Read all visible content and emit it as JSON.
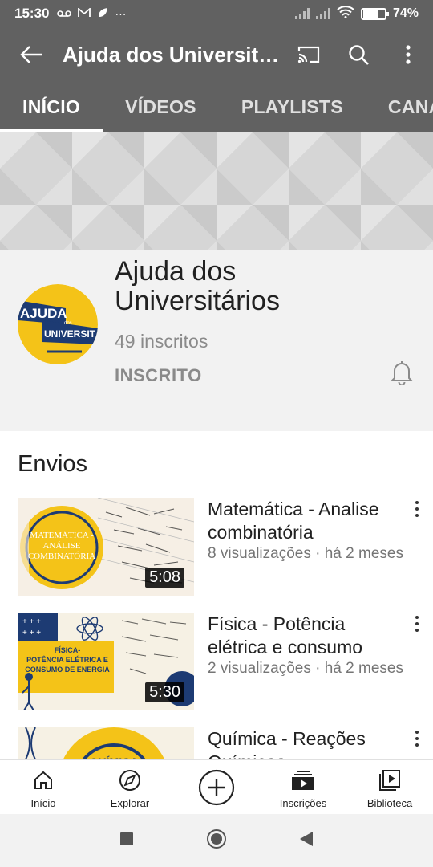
{
  "status_bar": {
    "time": "15:30",
    "battery": "74%",
    "battery_level": 0.74,
    "icons": [
      "voicemail-icon",
      "gmail-icon",
      "leaf-icon",
      "more-icon",
      "signal-icon",
      "signal-icon",
      "wifi-icon",
      "battery-icon"
    ],
    "more": "···"
  },
  "app_bar": {
    "title": "Ajuda dos Universit…",
    "icons": [
      "back-arrow-icon",
      "cast-icon",
      "search-icon",
      "more-vert-icon"
    ]
  },
  "tabs": [
    {
      "label": "INÍCIO",
      "active": true
    },
    {
      "label": "VÍDEOS",
      "active": false
    },
    {
      "label": "PLAYLISTS",
      "active": false
    },
    {
      "label": "CANA",
      "active": false
    }
  ],
  "channel": {
    "name": "Ajuda dos Universitários",
    "subscribers": "49 inscritos",
    "subscribed_label": "INSCRITO",
    "avatar": {
      "line1": "AJUDA",
      "line2": "dos",
      "line3": "UNIVERSITÁR",
      "colors": {
        "yellow": "#f4c318",
        "navy": "#1d3b73"
      }
    }
  },
  "section": {
    "title": "Envios"
  },
  "videos": [
    {
      "title": "Matemática - Analise combinatória",
      "meta": "8 visualizações · há 2 meses",
      "duration": "5:08",
      "thumb_text": "MATEMÁTICA - ANÁLISE COMBINATÓRIA"
    },
    {
      "title": "Física - Potência elétrica e consumo",
      "meta": "2 visualizações · há 2 meses",
      "duration": "5:30",
      "thumb_text": "FÍSICA- POTÊNCIA ELÉTRICA E CONSUMO DE ENERGIA"
    },
    {
      "title": "Química - Reações Químicas",
      "meta": "",
      "duration": "",
      "thumb_text": "QUÍMICA"
    }
  ],
  "bottom_nav": [
    {
      "label": "Início",
      "icon": "home-icon"
    },
    {
      "label": "Explorar",
      "icon": "compass-icon"
    },
    {
      "label": "",
      "icon": "create-icon"
    },
    {
      "label": "Inscrições",
      "icon": "subscriptions-icon"
    },
    {
      "label": "Biblioteca",
      "icon": "library-icon"
    }
  ],
  "system_nav": [
    "recents-icon",
    "home-button-icon",
    "back-icon"
  ],
  "colors": {
    "appbar": "#616161",
    "channel_bg": "#f2f2f2",
    "text": "#212121",
    "muted": "#757575"
  }
}
